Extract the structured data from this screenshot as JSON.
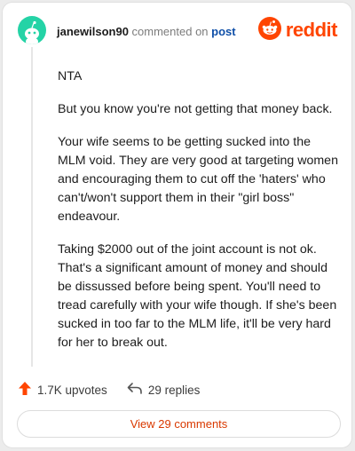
{
  "header": {
    "username": "janewilson90",
    "action_text": "commented on",
    "link_text": "post",
    "logo_text": "reddit",
    "icons": {
      "avatar": "reddit-snoo-avatar",
      "logo": "reddit-alien-icon"
    }
  },
  "comment": {
    "paragraphs": [
      "NTA",
      "But you know you're not getting that money back.",
      "Your wife seems to be getting sucked into the MLM void. They are very good at targeting women and encouraging them to cut off the 'haters' who can't/won't support them in their \"girl boss\" endeavour.",
      "Taking $2000 out of the joint account is not ok. That's a significant amount of money and should be dissussed before being spent. You'll need to tread carefully with your wife though. If she's been sucked in too far to the MLM life, it'll be very hard for her to break out."
    ]
  },
  "footer": {
    "upvotes": "1.7K upvotes",
    "replies": "29 replies",
    "view_comments": "View 29 comments",
    "icons": {
      "upvote": "upvote-arrow-icon",
      "reply": "reply-arrow-icon"
    }
  },
  "colors": {
    "accent": "#ff4500",
    "avatar_bg": "#24d3a6",
    "link": "#0f4fa8"
  }
}
